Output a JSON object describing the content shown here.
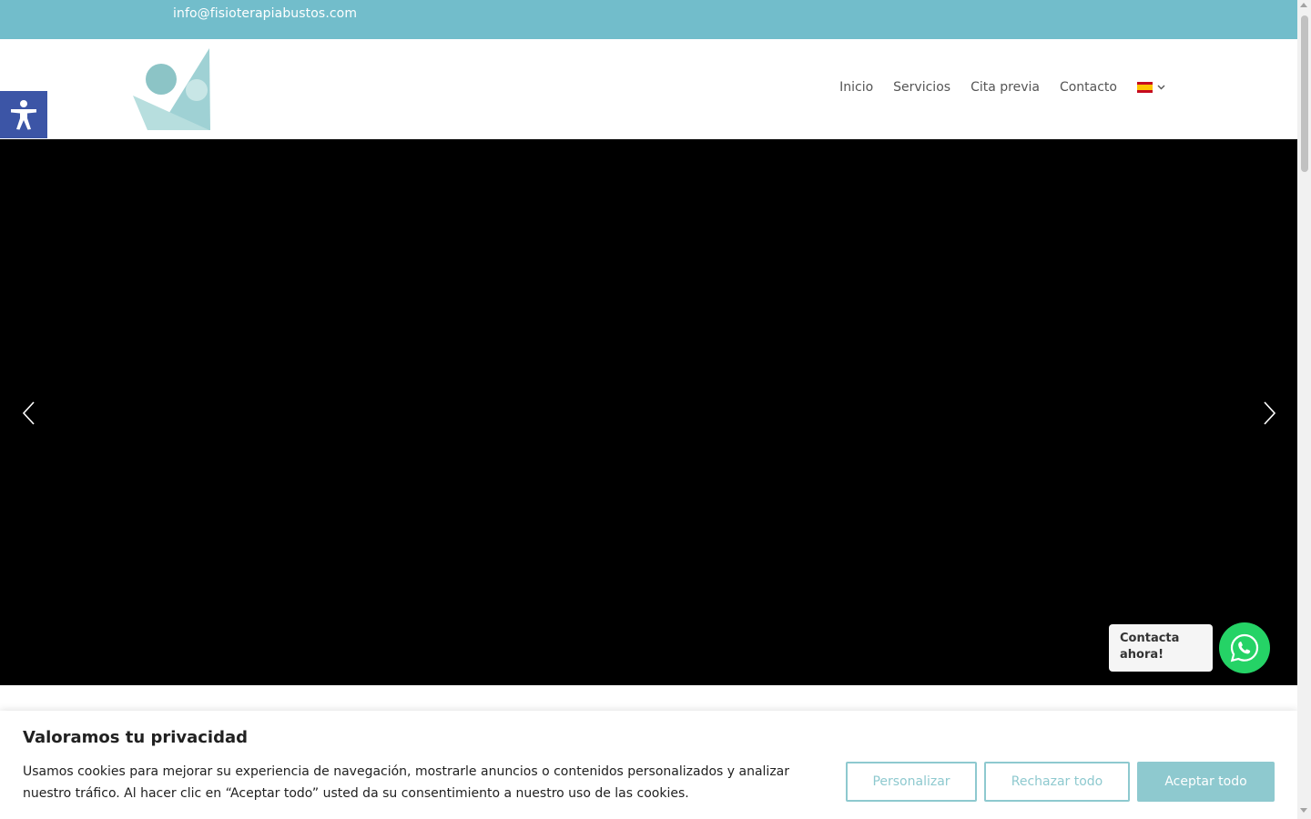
{
  "topbar": {
    "email": "info@fisioterapiabustos.com",
    "background": "#72bdcb"
  },
  "header": {
    "logo_icon": "fisioterapia-bustos-logo",
    "nav": [
      {
        "label": "Inicio"
      },
      {
        "label": "Servicios"
      },
      {
        "label": "Cita previa"
      },
      {
        "label": "Contacto"
      }
    ],
    "language_flag": "spain-flag-icon"
  },
  "accessibility": {
    "icon": "accessibility-icon",
    "color": "#3c55a6"
  },
  "hero": {
    "background": "#000000",
    "prev_icon": "chevron-left-icon",
    "next_icon": "chevron-right-icon"
  },
  "whatsapp": {
    "bubble_text": "Contacta ahora!",
    "icon": "whatsapp-icon",
    "color": "#25d366"
  },
  "cookie_banner": {
    "title": "Valoramos tu privacidad",
    "text": "Usamos cookies para mejorar su experiencia de navegación, mostrarle anuncios o contenidos personalizados y analizar nuestro tráfico. Al hacer clic en “Aceptar todo” usted da su consentimiento a nuestro uso de las cookies.",
    "customize_label": "Personalizar",
    "reject_label": "Rechazar todo",
    "accept_label": "Aceptar todo",
    "accent": "#8ec9cf"
  }
}
